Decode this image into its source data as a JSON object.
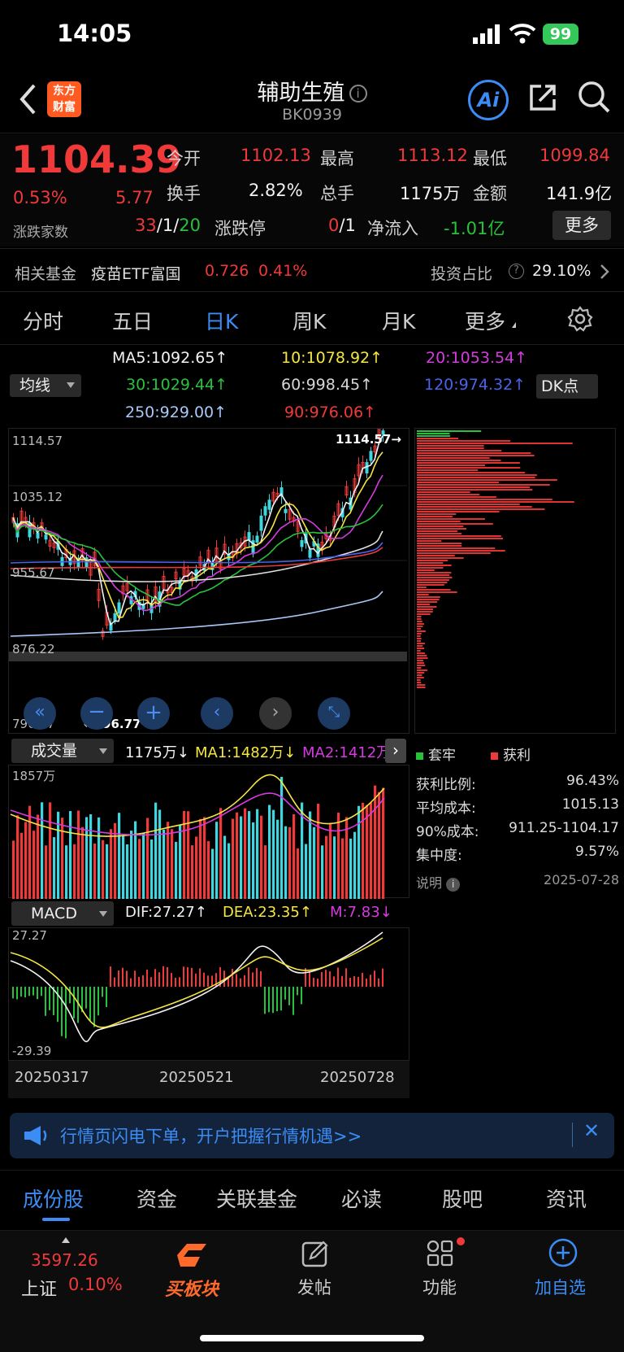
{
  "status": {
    "time": "14:05",
    "battery": "99"
  },
  "header": {
    "title": "辅助生殖",
    "code": "BK0939",
    "logo_top": "东方",
    "logo_bottom": "财富",
    "ai_label": "Ai"
  },
  "quote": {
    "price": "1104.39",
    "pct": "0.53%",
    "chg": "5.77",
    "open_label": "今开",
    "open": "1102.13",
    "high_label": "最高",
    "high": "1113.12",
    "low_label": "最低",
    "low": "1099.84",
    "turnover_label": "换手",
    "turnover": "2.82%",
    "volume_label": "总手",
    "volume": "1175万",
    "amount_label": "金额",
    "amount": "141.9亿",
    "breadth_label": "涨跌家数",
    "breadth_up": "33",
    "breadth_flat": "1",
    "breadth_down": "20",
    "limit_label": "涨跌停",
    "limit_up": "0",
    "limit_down": "1",
    "inflow_label": "净流入",
    "inflow": "-1.01亿",
    "more": "更多"
  },
  "fund": {
    "label": "相关基金",
    "name": "疫苗ETF富国",
    "price": "0.726",
    "pct": "0.41%",
    "ratio_label": "投资占比",
    "ratio": "29.10%"
  },
  "tabs": [
    {
      "label": "分时"
    },
    {
      "label": "五日"
    },
    {
      "label": "日K"
    },
    {
      "label": "周K"
    },
    {
      "label": "月K"
    },
    {
      "label": "更多"
    }
  ],
  "ma": {
    "selector": "均线",
    "dk": "DK点",
    "ma5": "MA5:1092.65↑",
    "ma10": "10:1078.92↑",
    "ma20": "20:1053.54↑",
    "ma30": "30:1029.44↑",
    "ma60": "60:998.45↑",
    "ma120": "120:974.32↑",
    "ma250": "250:929.00↑",
    "ma90": "90:976.06↑"
  },
  "kline": {
    "y_labels": [
      "1114.57",
      "1035.12",
      "955.67",
      "876.22",
      "796.77"
    ],
    "max_mark": "1114.57",
    "min_mark": "796.77"
  },
  "volume": {
    "selector": "成交量",
    "vol": "1175万↓",
    "ma1": "MA1:1482万↓",
    "ma2": "MA2:1412万",
    "y_max": "1857万"
  },
  "macd": {
    "selector": "MACD",
    "dif": "DIF:27.27↑",
    "dea": "DEA:23.35↑",
    "m": "M:7.83↓",
    "y_top": "27.27",
    "y_bottom": "-29.39"
  },
  "dates": [
    "20250317",
    "20250521",
    "20250728"
  ],
  "chips": {
    "legend_trapped": "套牢",
    "legend_profit": "获利",
    "rows": [
      {
        "k": "获利比例:",
        "v": "96.43%"
      },
      {
        "k": "平均成本:",
        "v": "1015.13"
      },
      {
        "k": "90%成本:",
        "v": "911.25-1104.17"
      },
      {
        "k": "集中度:",
        "v": "9.57%"
      }
    ],
    "note": "说明",
    "date": "2025-07-28"
  },
  "banner": {
    "text": "行情页闪电下单，开户把握行情机遇>>"
  },
  "bottom_tabs": [
    {
      "label": "成份股"
    },
    {
      "label": "资金"
    },
    {
      "label": "关联基金"
    },
    {
      "label": "必读"
    },
    {
      "label": "股吧"
    },
    {
      "label": "资讯"
    }
  ],
  "nav": {
    "index_value": "3597.26",
    "index_name": "上证",
    "index_pct": "0.10%",
    "buy": "买板块",
    "post": "发帖",
    "func": "功能",
    "add": "加自选"
  },
  "colors": {
    "red": "#f03a3a",
    "green": "#27c23c",
    "blue": "#3b8cf5",
    "cyan": "#3fd6e0",
    "yellow": "#f5e642",
    "magenta": "#d63be0"
  }
}
